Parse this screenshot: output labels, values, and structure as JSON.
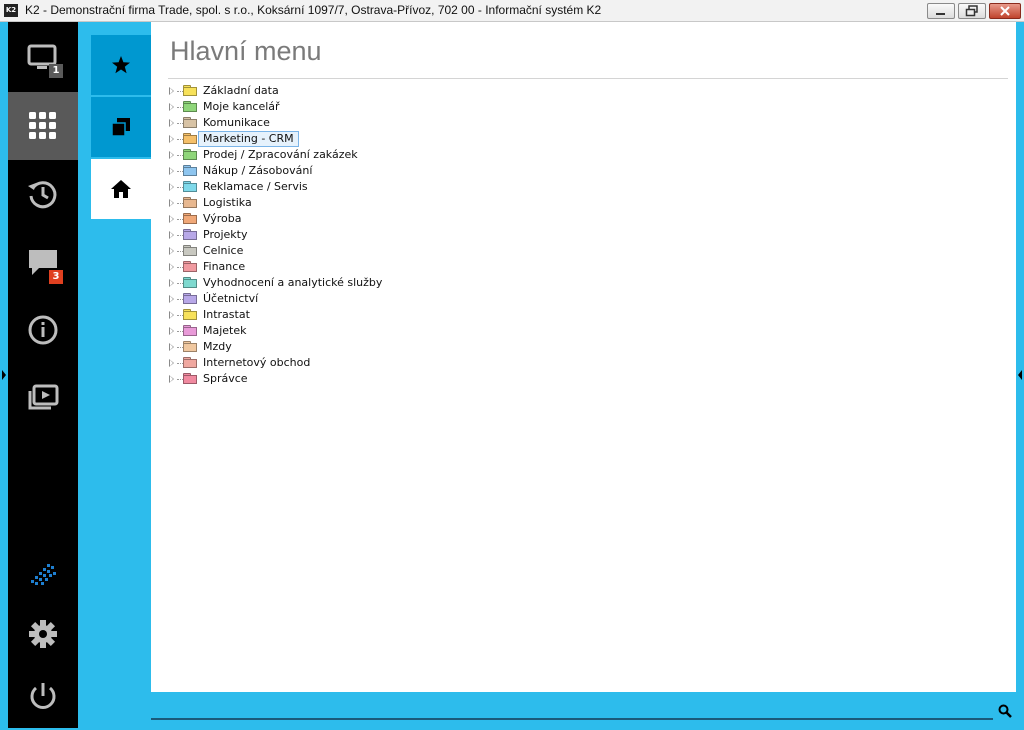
{
  "window": {
    "logo_text": "K2",
    "title": "K2 - Demonstrační firma Trade, spol. s r.o., Koksární 1097/7, Ostrava-Přívoz, 702 00 - Informační systém K2",
    "controls": [
      "minimize-icon",
      "restore-icon",
      "close-icon"
    ]
  },
  "sidebar": {
    "items": [
      {
        "name": "monitor",
        "icon": "monitor-icon",
        "badge": "1"
      },
      {
        "name": "apps",
        "icon": "apps-grid-icon",
        "active": true
      },
      {
        "name": "history",
        "icon": "history-clock-icon"
      },
      {
        "name": "messages",
        "icon": "chat-bubble-icon",
        "badge": "3"
      },
      {
        "name": "info",
        "icon": "info-icon"
      },
      {
        "name": "media",
        "icon": "video-library-icon"
      }
    ],
    "bottom": [
      "k2-logo-icon",
      "settings-gear-icon",
      "power-icon"
    ]
  },
  "tabs": [
    {
      "name": "favorites",
      "icon": "star-icon"
    },
    {
      "name": "windows",
      "icon": "copy-windows-icon"
    },
    {
      "name": "home",
      "icon": "home-icon",
      "active": true
    }
  ],
  "main": {
    "title": "Hlavní menu",
    "tree": [
      {
        "label": "Základní data",
        "color": "#f7e15a"
      },
      {
        "label": "Moje kancelář",
        "color": "#8fd67a"
      },
      {
        "label": "Komunikace",
        "color": "#d8c3a5"
      },
      {
        "label": "Marketing - CRM",
        "color": "#f5c06a",
        "selected": true
      },
      {
        "label": "Prodej / Zpracování zakázek",
        "color": "#8fd67a"
      },
      {
        "label": "Nákup / Zásobování",
        "color": "#8ec5ef"
      },
      {
        "label": "Reklamace / Servis",
        "color": "#7fd9ea"
      },
      {
        "label": "Logistika",
        "color": "#e8b890"
      },
      {
        "label": "Výroba",
        "color": "#f0a878"
      },
      {
        "label": "Projekty",
        "color": "#b8a8e8"
      },
      {
        "label": "Celnice",
        "color": "#c8c8c0"
      },
      {
        "label": "Finance",
        "color": "#f09aa0"
      },
      {
        "label": "Vyhodnocení a analytické služby",
        "color": "#7fd9cf"
      },
      {
        "label": "Účetnictví",
        "color": "#b8a8e8"
      },
      {
        "label": "Intrastat",
        "color": "#f7e15a"
      },
      {
        "label": "Majetek",
        "color": "#e89ad8"
      },
      {
        "label": "Mzdy",
        "color": "#f0c8a0"
      },
      {
        "label": "Internetový obchod",
        "color": "#f0a8a0"
      },
      {
        "label": "Správce",
        "color": "#f08aa0"
      }
    ]
  },
  "footer": {
    "search_icon": "search-icon"
  }
}
